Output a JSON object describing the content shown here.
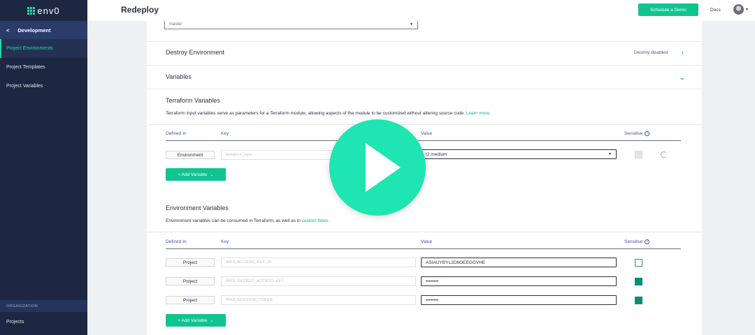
{
  "app": {
    "brand": "env0"
  },
  "sidebar": {
    "section_label": "Development",
    "back_glyph": "<",
    "items": [
      {
        "label": "Project Environments"
      },
      {
        "label": "Project Templates"
      },
      {
        "label": "Project Variables"
      }
    ],
    "org_header": "ORGANIZATION",
    "org_items": [
      {
        "label": "Projects"
      }
    ]
  },
  "topbar": {
    "title": "Redeploy",
    "schedule_demo": "Schedule a Demo",
    "docs": "Docs"
  },
  "revision_select": {
    "value": "master"
  },
  "destroy": {
    "title": "Destroy Environment",
    "status": "Destroy disabled"
  },
  "variables": {
    "title": "Variables"
  },
  "terraform": {
    "title": "Terraform Variables",
    "description": "Terraform input variables serve as parameters for a Terraform module, allowing aspects of the module to be customized without altering source code.",
    "learn_more": "Learn more.",
    "columns": {
      "defined_in": "Defined In",
      "key": "Key",
      "value": "Value",
      "sensitive": "Sensitive"
    },
    "rows": [
      {
        "defined_in": "Environment",
        "key_placeholder": "instance_type",
        "value": "t2.medium",
        "sensitive": false
      }
    ],
    "add_button": "+ Add Variable"
  },
  "environment": {
    "title": "Environment Variables",
    "description": "Environment variables can be consumed in Terraform, as well as in",
    "link": "custom flows.",
    "columns": {
      "defined_in": "Defined In",
      "key": "Key",
      "value": "Value",
      "sensitive": "Sensitive"
    },
    "rows": [
      {
        "defined_in": "Project",
        "key_placeholder": "AWS_ACCESS_KEY_ID",
        "value": "ASIAUYBYL2D6OEEGGVHE",
        "sensitive": false
      },
      {
        "defined_in": "Project",
        "key_placeholder": "AWS_SECRET_ACCESS_KEY",
        "value": "••••••••",
        "sensitive": true
      },
      {
        "defined_in": "Project",
        "key_placeholder": "AWS_SESSION_TOKEN",
        "value": "••••••••",
        "sensitive": true
      }
    ],
    "add_button": "+ Add Variable"
  },
  "icons": {
    "back": "chevron-left-icon",
    "expand_right": "chevron-right-icon",
    "expand_down": "chevron-down-icon",
    "info": "info-icon",
    "play": "play-icon"
  },
  "colors": {
    "accent": "#10c48f",
    "sidebar": "#1d2741",
    "play": "#1ee5b1"
  }
}
